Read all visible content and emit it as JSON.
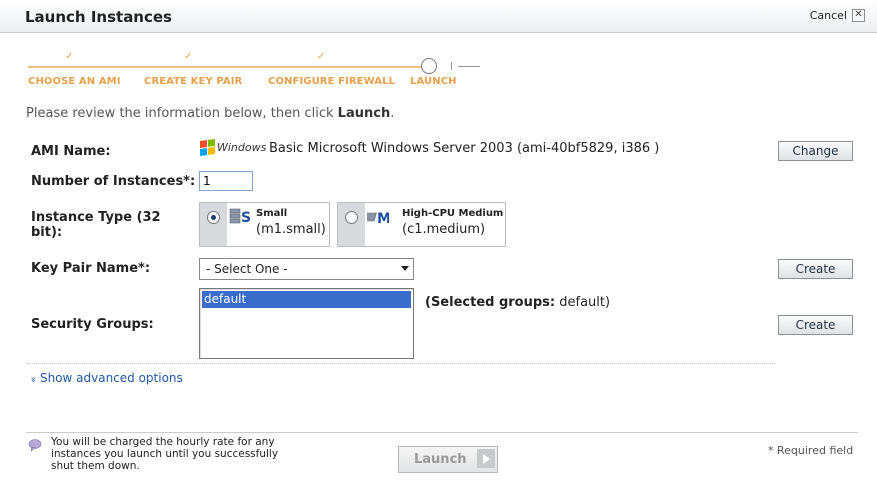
{
  "dialog": {
    "title": "Launch Instances",
    "cancel_label": "Cancel",
    "close_glyph": "✕"
  },
  "wizard": {
    "steps": [
      {
        "label": "CHOOSE AN AMI",
        "state": "done"
      },
      {
        "label": "CREATE KEY PAIR",
        "state": "done"
      },
      {
        "label": "CONFIGURE FIREWALL",
        "state": "done"
      },
      {
        "label": "LAUNCH",
        "state": "current"
      }
    ],
    "check_glyph": "✓"
  },
  "instructions": {
    "prefix": "Please review the information below, then click ",
    "bold": "Launch",
    "suffix": "."
  },
  "ami": {
    "label": "AMI Name:",
    "logo_text": "Windows",
    "value": "Basic Microsoft Windows Server 2003 (ami-40bf5829, i386 )",
    "change_label": "Change"
  },
  "instances": {
    "label": "Number of Instances*:",
    "value": "1"
  },
  "instance_type": {
    "label": "Instance Type (32 bit):",
    "options": [
      {
        "name": "Small",
        "code": "(m1.small)",
        "letter": "S",
        "selected": true
      },
      {
        "name": "High-CPU Medium",
        "code": "(c1.medium)",
        "letter": "M",
        "selected": false
      }
    ]
  },
  "key_pair": {
    "label": "Key Pair Name*:",
    "selected": "- Select One -",
    "create_label": "Create"
  },
  "security": {
    "label": "Security Groups:",
    "items": [
      "default"
    ],
    "selected_label": "(Selected groups:",
    "selected_value": " default)",
    "create_label": "Create"
  },
  "advanced": {
    "label": "Show advanced options",
    "icon": "»"
  },
  "footer": {
    "charge_text": "You will be charged the hourly rate for any instances you launch until you successfully shut them down.",
    "launch_label": "Launch",
    "required_note": "* Required field"
  },
  "colors": {
    "accent_orange": "#e8a04a",
    "link_blue": "#1f5aa8",
    "selection_blue": "#3a6ccc"
  }
}
